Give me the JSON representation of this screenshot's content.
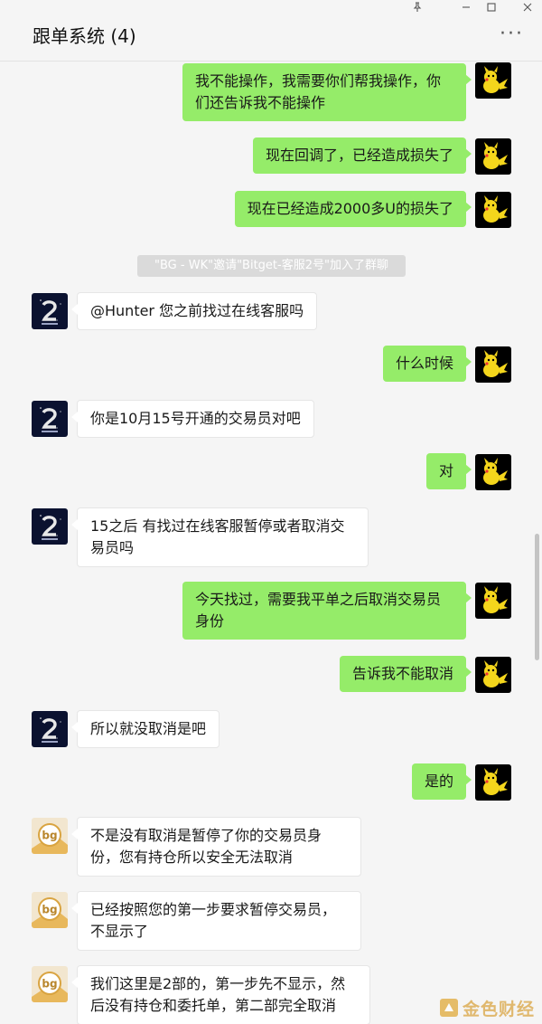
{
  "window": {
    "pin_icon": "pin-icon",
    "minimize_icon": "minimize-icon",
    "maximize_icon": "maximize-icon",
    "close_icon": "close-icon"
  },
  "header": {
    "title": "跟单系统 (4)",
    "more_label": "···"
  },
  "system_note": "\"BG - WK\"邀请\"Bitget-客服2号\"加入了群聊",
  "messages": [
    {
      "side": "right",
      "avatar": "pikachu-avatar",
      "text": "我不能操作，我需要你们帮我操作，你们还告诉我不能操作"
    },
    {
      "side": "right",
      "avatar": "pikachu-avatar",
      "text": "现在回调了，已经造成损失了"
    },
    {
      "side": "right",
      "avatar": "pikachu-avatar",
      "text": "现在已经造成2000多U的损失了"
    },
    {
      "side": "left",
      "avatar": "bitget-2-avatar",
      "text": "@Hunter  您之前找过在线客服吗"
    },
    {
      "side": "right",
      "avatar": "pikachu-avatar",
      "text": "什么时候"
    },
    {
      "side": "left",
      "avatar": "bitget-2-avatar",
      "text": "你是10月15号开通的交易员对吧"
    },
    {
      "side": "right",
      "avatar": "pikachu-avatar",
      "text": "对"
    },
    {
      "side": "left",
      "avatar": "bitget-2-avatar",
      "text": "15之后 有找过在线客服暂停或者取消交易员吗"
    },
    {
      "side": "right",
      "avatar": "pikachu-avatar",
      "text": "今天找过，需要我平单之后取消交易员身份"
    },
    {
      "side": "right",
      "avatar": "pikachu-avatar",
      "text": "告诉我不能取消"
    },
    {
      "side": "left",
      "avatar": "bitget-2-avatar",
      "text": "所以就没取消是吧"
    },
    {
      "side": "right",
      "avatar": "pikachu-avatar",
      "text": "是的"
    },
    {
      "side": "left",
      "avatar": "bg-logo-avatar",
      "text": "不是没有取消是暂停了你的交易员身份，您有持仓所以安全无法取消"
    },
    {
      "side": "left",
      "avatar": "bg-logo-avatar",
      "text": "已经按照您的第一步要求暂停交易员，不显示了"
    },
    {
      "side": "left",
      "avatar": "bg-logo-avatar",
      "text": "我们这里是2部的，第一步先不显示，然后没有持仓和委托单，第二部完全取消"
    }
  ],
  "watermark": {
    "text": "金色财经",
    "logo": "jinse-logo-icon"
  },
  "colors": {
    "own_bubble": "#95ec69",
    "other_bubble": "#ffffff",
    "background": "#f5f5f5"
  }
}
